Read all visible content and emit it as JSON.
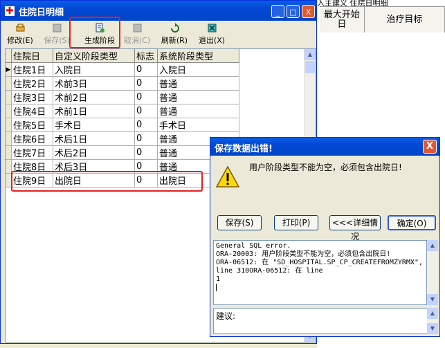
{
  "background_window": {
    "top_text": "入主建义  住院日明细",
    "col1_label": "最大开始日",
    "col2_label": "治疗目标"
  },
  "main_window": {
    "title": "住院日明细",
    "buttons": {
      "minimize": "_",
      "maximize": "□",
      "close": "X"
    },
    "toolbar": [
      {
        "label": "修改(E)",
        "icon": "edit-icon",
        "enabled": true
      },
      {
        "label": "保存(S)",
        "icon": "save-icon",
        "enabled": false
      },
      {
        "label": "生成阶段",
        "icon": "generate-icon",
        "enabled": true
      },
      {
        "label": "取消(C)",
        "icon": "cancel-icon",
        "enabled": false
      },
      {
        "label": "刷新(R)",
        "icon": "refresh-icon",
        "enabled": true
      },
      {
        "label": "退出(X)",
        "icon": "exit-icon",
        "enabled": true
      }
    ],
    "grid": {
      "columns": [
        "住院日",
        "自定义阶段类型",
        "标志",
        "系统阶段类型"
      ],
      "current_row_marker": "▶",
      "rows": [
        [
          "住院1日",
          "入院日",
          "0",
          "入院日"
        ],
        [
          "住院2日",
          "术前3日",
          "0",
          "普通"
        ],
        [
          "住院3日",
          "术前2日",
          "0",
          "普通"
        ],
        [
          "住院4日",
          "术前1日",
          "0",
          "普通"
        ],
        [
          "住院5日",
          "手术日",
          "0",
          "手术日"
        ],
        [
          "住院6日",
          "术后1日",
          "0",
          "普通"
        ],
        [
          "住院7日",
          "术后2日",
          "0",
          "普通"
        ],
        [
          "住院8日",
          "术后3日",
          "0",
          "普通"
        ],
        [
          "住院9日",
          "出院日",
          "0",
          "出院日"
        ]
      ]
    }
  },
  "dialog": {
    "title": "保存数据出错!",
    "close": "X",
    "message": "用户阶段类型不能为空，必须包含出院日!",
    "buttons": {
      "save": "保存(S)",
      "print": "打印(P)",
      "details": "<<<详细情况",
      "ok": "确定(O)"
    },
    "error_text": "General SQL error.\nORA-20003: 用户阶段类型不能为空，必须包含出院日!\nORA-06512: 在 \"SD_HOSPITAL.SP_CP_CREATEFROMZYRMX\",\nline 310ORA-06512: 在 line\n1",
    "suggestion_label": "建议:",
    "suggestion_value": ""
  }
}
